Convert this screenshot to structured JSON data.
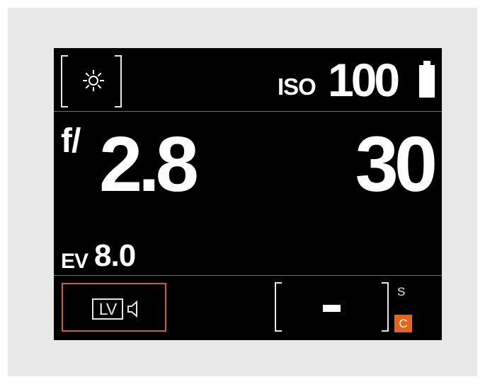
{
  "header": {
    "iso_label": "ISO",
    "iso_value": "100",
    "mode_icon": "sun-icon",
    "battery_icon": "battery-icon"
  },
  "exposure": {
    "aperture_prefix": "f/",
    "aperture_value": "2.8",
    "shutter_value": "30",
    "ev_label": "EV",
    "ev_value": "8.0"
  },
  "footer": {
    "lv_label": "LV",
    "lv_icon": "speaker-icon",
    "status_value": "-",
    "s_label": "S",
    "c_label": "C"
  },
  "colors": {
    "accent": "#e0671d",
    "lv_border": "#c6622a",
    "screen_bg": "#000000",
    "text": "#ffffff"
  }
}
